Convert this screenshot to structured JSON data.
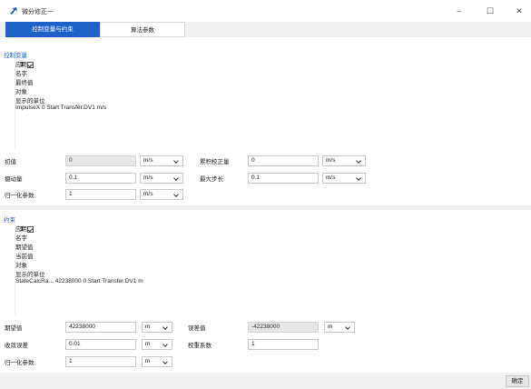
{
  "window": {
    "title": "微分修正一",
    "minimize": "–",
    "maximize": "☐",
    "close": "✕"
  },
  "tabs": [
    {
      "label": "控制变量与约束"
    },
    {
      "label": "算法参数"
    }
  ],
  "control": {
    "section_label": "控制变量",
    "headers": [
      "应用",
      "名字",
      "最终值",
      "对象",
      "显示的单位"
    ],
    "rows": [
      {
        "index": "1",
        "checked": true,
        "name": "ImpulseX",
        "final": "0",
        "object": "Start Transfer.DV1",
        "unit": "m/s"
      }
    ],
    "form": {
      "initial_label": "初值",
      "initial_value": "0",
      "initial_unit": "m/s",
      "perturb_label": "摄动量",
      "perturb_value": "0.1",
      "perturb_unit": "m/s",
      "normalize_label": "归一化参数",
      "normalize_value": "1",
      "normalize_unit": "m/s",
      "correction_label": "累积校正量",
      "correction_value": "0",
      "correction_unit": "m/s",
      "maxstep_label": "最大步长",
      "maxstep_value": "0.1",
      "maxstep_unit": "m/s"
    }
  },
  "constraint": {
    "section_label": "约束",
    "headers": [
      "应用",
      "名字",
      "期望值",
      "当前值",
      "对象",
      "显示的单位"
    ],
    "rows": [
      {
        "index": "1",
        "checked": true,
        "name": "StateCalcRa...",
        "desired": "42238000",
        "current": "0",
        "object": "Start Transfer.DV1",
        "unit": "m"
      }
    ],
    "form": {
      "desired_label": "期望值",
      "desired_value": "42238000",
      "desired_unit": "m",
      "tolerance_label": "收敛误差",
      "tolerance_value": "0.01",
      "tolerance_unit": "m",
      "normalize_label": "归一化参数",
      "normalize_value": "1",
      "normalize_unit": "m",
      "error_label": "误差值",
      "error_value": "-42238000",
      "error_unit": "m",
      "weight_label": "权重系数",
      "weight_value": "1"
    }
  },
  "footer": {
    "ok_label": "确定"
  }
}
